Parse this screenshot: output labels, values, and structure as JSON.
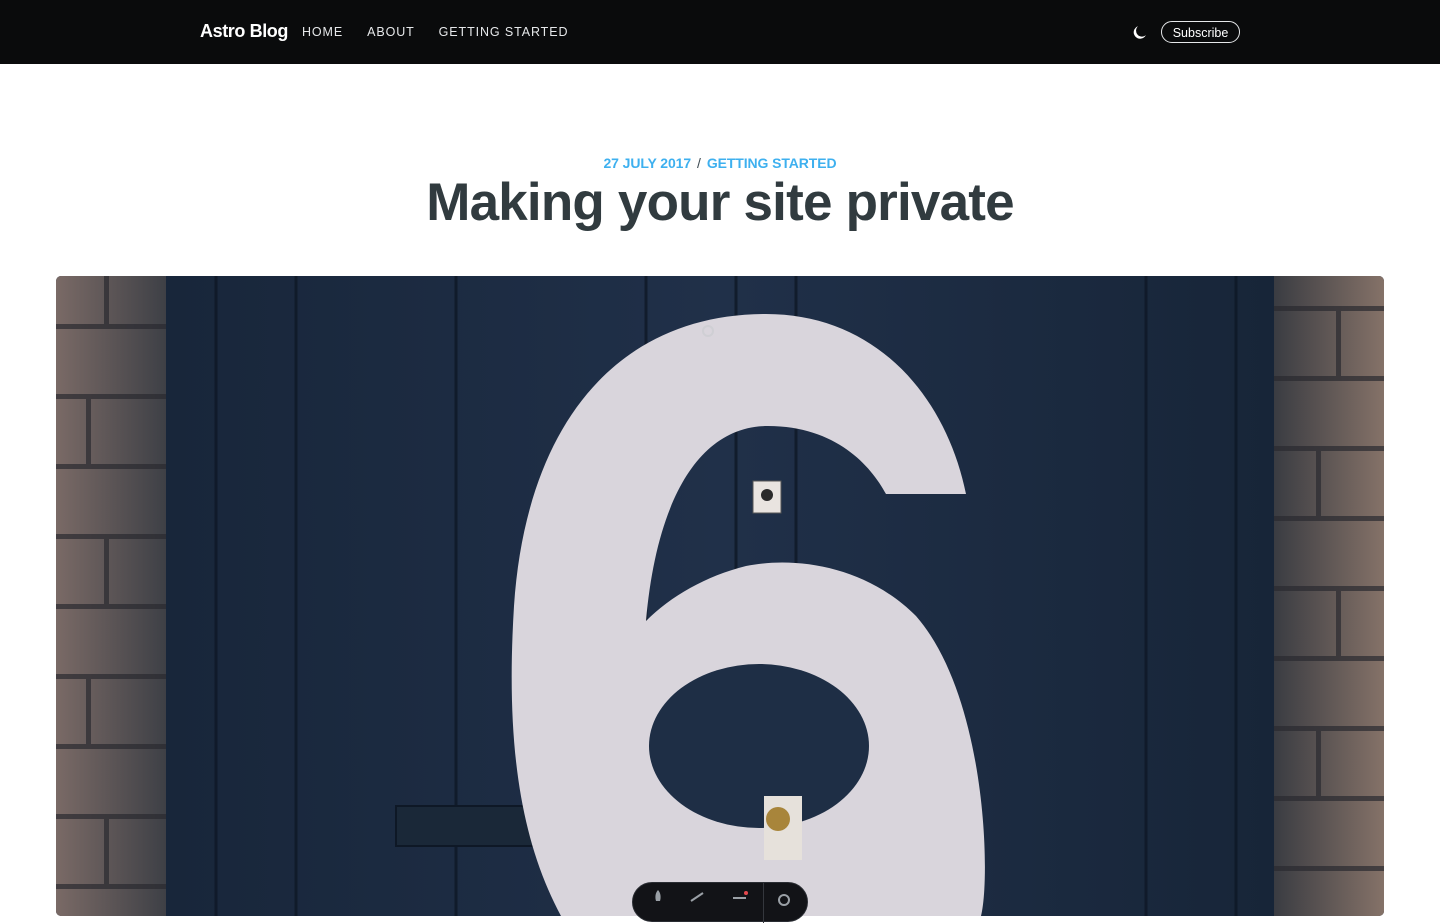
{
  "header": {
    "brand": "Astro Blog",
    "nav": [
      {
        "label": "HOME"
      },
      {
        "label": "ABOUT"
      },
      {
        "label": "GETTING STARTED"
      }
    ],
    "theme_toggle_icon": "moon-icon",
    "subscribe_label": "Subscribe"
  },
  "post": {
    "date": "27 JULY 2017",
    "separator": "/",
    "category": "GETTING STARTED",
    "title": "Making your site private"
  },
  "feature_image": {
    "subject": "6"
  },
  "dock": {
    "icons": [
      "rocket-icon",
      "ruler-icon",
      "menu-icon",
      "gear-icon"
    ],
    "notification_color": "#e5484d"
  },
  "colors": {
    "nav_bg": "#0a0b0c",
    "accent": "#3eb0ef",
    "title": "#313b3f"
  }
}
